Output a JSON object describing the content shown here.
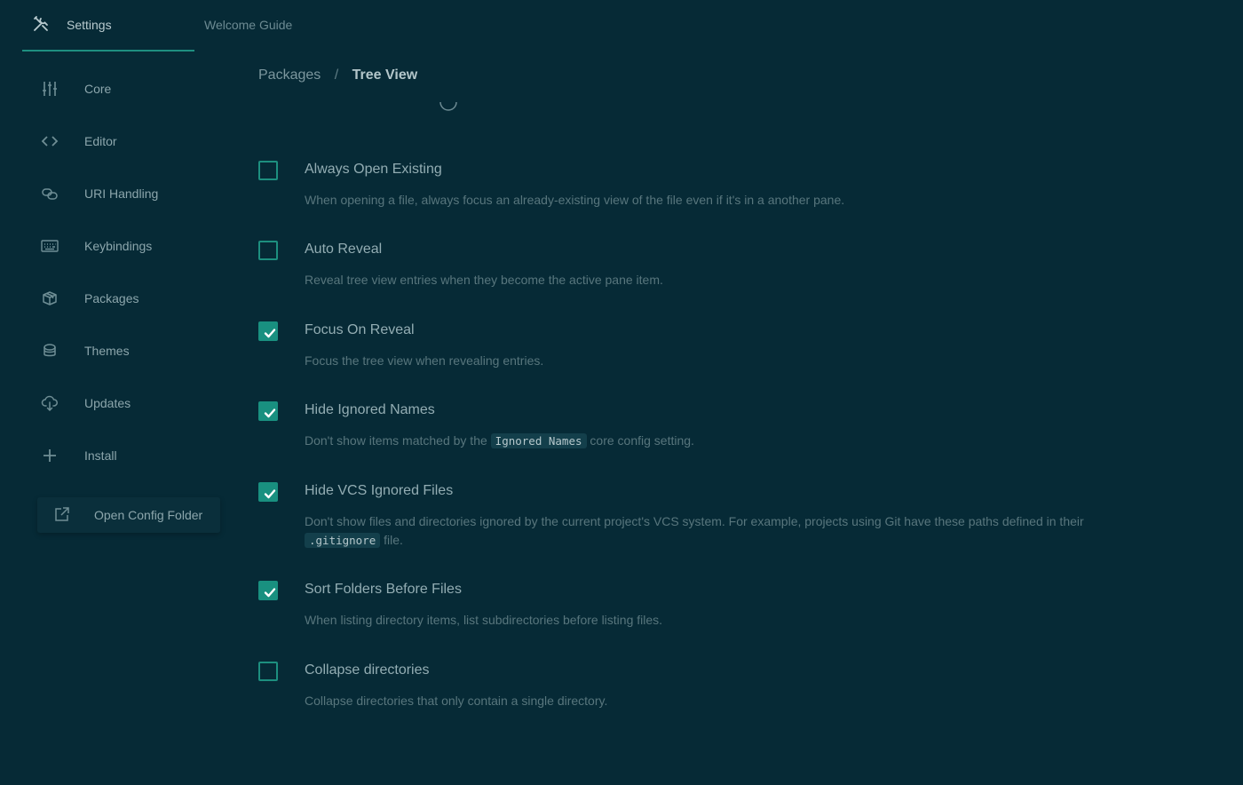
{
  "tabs": [
    {
      "label": "Settings",
      "icon": "tools-icon",
      "active": true
    },
    {
      "label": "Welcome Guide",
      "active": false
    }
  ],
  "sidebar": {
    "items": [
      {
        "label": "Core",
        "icon": "sliders-icon"
      },
      {
        "label": "Editor",
        "icon": "code-icon"
      },
      {
        "label": "URI Handling",
        "icon": "link-icon"
      },
      {
        "label": "Keybindings",
        "icon": "keyboard-icon"
      },
      {
        "label": "Packages",
        "icon": "package-icon"
      },
      {
        "label": "Themes",
        "icon": "paintcan-icon"
      },
      {
        "label": "Updates",
        "icon": "cloud-download-icon"
      },
      {
        "label": "Install",
        "icon": "plus-icon"
      }
    ],
    "open_config_label": "Open Config Folder"
  },
  "breadcrumb": {
    "parent": "Packages",
    "separator": "/",
    "current": "Tree View"
  },
  "settings": [
    {
      "title": "Always Open Existing",
      "checked": false,
      "desc": "When opening a file, always focus an already-existing view of the file even if it's in a another pane."
    },
    {
      "title": "Auto Reveal",
      "checked": false,
      "desc": "Reveal tree view entries when they become the active pane item."
    },
    {
      "title": "Focus On Reveal",
      "checked": true,
      "desc": "Focus the tree view when revealing entries."
    },
    {
      "title": "Hide Ignored Names",
      "checked": true,
      "desc_pre": "Don't show items matched by the ",
      "desc_code": "Ignored Names",
      "desc_post": " core config setting."
    },
    {
      "title": "Hide VCS Ignored Files",
      "checked": true,
      "desc_pre": "Don't show files and directories ignored by the current project's VCS system. For example, projects using Git have these paths defined in their ",
      "desc_code": ".gitignore",
      "desc_post": " file."
    },
    {
      "title": "Sort Folders Before Files",
      "checked": true,
      "desc": "When listing directory items, list subdirectories before listing files."
    },
    {
      "title": "Collapse directories",
      "checked": false,
      "desc": "Collapse directories that only contain a single directory."
    }
  ],
  "colors": {
    "background": "#062a36",
    "accent": "#199080"
  }
}
